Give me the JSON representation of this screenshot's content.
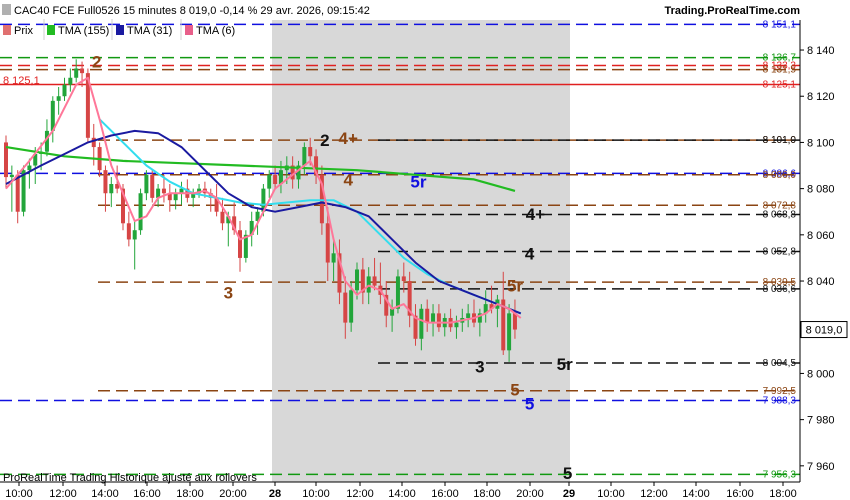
{
  "header": {
    "title": "CAC40 FCE Full0526 15 minutes 8 019,0 -0,14 % 29 avr. 2026, 09:15:42",
    "site": "Trading.ProRealTime.com"
  },
  "legend": [
    {
      "label": "Prix",
      "color": "#e07070"
    },
    {
      "label": "TMA (155)",
      "color": "#22bb22"
    },
    {
      "label": "TMA (31)",
      "color": "#1a1aa0"
    },
    {
      "label": "TMA (6)",
      "color": "#e85f8a"
    }
  ],
  "footer_note": "ProRealTime Trading  Historique ajusté aux rollovers",
  "price_label": "8 019,0",
  "left_label": "8 125,1",
  "colors": {
    "up": "#22a53a",
    "down": "#d64545",
    "red_line": "#e02020",
    "brown": "#8b4513",
    "blue": "#1010e0",
    "green": "#119911",
    "black": "#111111",
    "tma155": "#22bb22",
    "tma31": "#1a1aa0",
    "tma6": "#ff7799",
    "cyan": "#33ddee"
  },
  "chart_data": {
    "type": "candlestick",
    "y_ticks": [
      "8 140",
      "8 120",
      "8 100",
      "8 080",
      "8 060",
      "8 040",
      "8 020",
      "8 000",
      "7 980",
      "7 960"
    ],
    "y_values": [
      8140,
      8120,
      8100,
      8080,
      8060,
      8040,
      8020,
      8000,
      7980,
      7960
    ],
    "ylim": [
      7953,
      8153
    ],
    "x_ticks": [
      "10:00",
      "12:00",
      "14:00",
      "16:00",
      "18:00",
      "20:00",
      "28",
      "10:00",
      "12:00",
      "14:00",
      "16:00",
      "18:00",
      "20:00",
      "29",
      "10:00",
      "12:00",
      "14:00",
      "16:00",
      "18:00"
    ],
    "x_labels_bold": [
      "28",
      "29"
    ],
    "levels": [
      {
        "label": "8 151,1",
        "value": 8151.1,
        "color": "blue",
        "style": "dash"
      },
      {
        "label": "8 136,7",
        "value": 8136.7,
        "color": "green",
        "style": "dash"
      },
      {
        "label": "8 133,3",
        "value": 8133.3,
        "color": "red",
        "style": "dash"
      },
      {
        "label": "8 131,5",
        "value": 8131.5,
        "color": "brown",
        "style": "dash"
      },
      {
        "label": "8 125,1",
        "value": 8125.1,
        "color": "red_line",
        "style": "solid"
      },
      {
        "label": "8 101,0",
        "value": 8101.0,
        "color": "brown",
        "style": "dash"
      },
      {
        "label": "8 101,0",
        "value": 8101.0,
        "color": "black",
        "style": "dash"
      },
      {
        "label": "8 086,6",
        "value": 8086.6,
        "color": "blue",
        "style": "dash"
      },
      {
        "label": "8 086,0",
        "value": 8086.0,
        "color": "brown",
        "style": "dash"
      },
      {
        "label": "8 072,8",
        "value": 8072.8,
        "color": "brown",
        "style": "dash"
      },
      {
        "label": "8 068,8",
        "value": 8068.8,
        "color": "black",
        "style": "dash"
      },
      {
        "label": "8 052,8",
        "value": 8052.8,
        "color": "black",
        "style": "dash"
      },
      {
        "label": "8 039,5",
        "value": 8039.5,
        "color": "brown",
        "style": "dash"
      },
      {
        "label": "8 036,6",
        "value": 8036.6,
        "color": "black",
        "style": "dash"
      },
      {
        "label": "8 004,5",
        "value": 8004.5,
        "color": "black",
        "style": "dash"
      },
      {
        "label": "7 992,5",
        "value": 7992.5,
        "color": "brown",
        "style": "dash"
      },
      {
        "label": "7 988,3",
        "value": 7988.3,
        "color": "blue",
        "style": "dash"
      },
      {
        "label": "7 956,3",
        "value": 7956.3,
        "color": "green",
        "style": "dash"
      }
    ],
    "annotations": [
      {
        "text": "2",
        "x": 15.5,
        "y": 8135,
        "color": "brown"
      },
      {
        "text": "2",
        "x": 54.5,
        "y": 8101,
        "color": "black"
      },
      {
        "text": "4+",
        "x": 58.5,
        "y": 8102,
        "color": "brown"
      },
      {
        "text": "4",
        "x": 58.5,
        "y": 8084,
        "color": "brown"
      },
      {
        "text": "5r",
        "x": 70.5,
        "y": 8083,
        "color": "blue"
      },
      {
        "text": "4+",
        "x": 90.5,
        "y": 8069,
        "color": "black"
      },
      {
        "text": "4",
        "x": 89.5,
        "y": 8052,
        "color": "black"
      },
      {
        "text": "3",
        "x": 38,
        "y": 8035,
        "color": "brown"
      },
      {
        "text": "5r",
        "x": 87,
        "y": 8038,
        "color": "brown"
      },
      {
        "text": "5r",
        "x": 95.5,
        "y": 8004,
        "color": "black"
      },
      {
        "text": "3",
        "x": 81,
        "y": 8003,
        "color": "black"
      },
      {
        "text": "5",
        "x": 87,
        "y": 7993,
        "color": "brown"
      },
      {
        "text": "5",
        "x": 89.5,
        "y": 7987,
        "color": "blue"
      },
      {
        "text": "5",
        "x": 96,
        "y": 7957,
        "color": "black"
      }
    ],
    "ohlc": [
      [
        8100,
        8103,
        8080,
        8085
      ],
      [
        8085,
        8090,
        8070,
        8086
      ],
      [
        8086,
        8088,
        8065,
        8070
      ],
      [
        8070,
        8090,
        8068,
        8088
      ],
      [
        8088,
        8093,
        8080,
        8090
      ],
      [
        8090,
        8098,
        8082,
        8095
      ],
      [
        8095,
        8100,
        8088,
        8096
      ],
      [
        8096,
        8110,
        8094,
        8105
      ],
      [
        8105,
        8120,
        8100,
        8118
      ],
      [
        8118,
        8124,
        8112,
        8120
      ],
      [
        8120,
        8128,
        8118,
        8125
      ],
      [
        8125,
        8132,
        8122,
        8128
      ],
      [
        8128,
        8136,
        8126,
        8132
      ],
      [
        8132,
        8135,
        8124,
        8130
      ],
      [
        8130,
        8132,
        8100,
        8102
      ],
      [
        8102,
        8108,
        8090,
        8098
      ],
      [
        8098,
        8100,
        8085,
        8088
      ],
      [
        8088,
        8090,
        8070,
        8078
      ],
      [
        8078,
        8085,
        8072,
        8082
      ],
      [
        8082,
        8090,
        8078,
        8080
      ],
      [
        8080,
        8082,
        8062,
        8065
      ],
      [
        8065,
        8070,
        8055,
        8058
      ],
      [
        8058,
        8066,
        8045,
        8062
      ],
      [
        8062,
        8080,
        8060,
        8078
      ],
      [
        8078,
        8088,
        8075,
        8086
      ],
      [
        8086,
        8088,
        8074,
        8076
      ],
      [
        8076,
        8082,
        8072,
        8080
      ],
      [
        8080,
        8086,
        8074,
        8078
      ],
      [
        8078,
        8082,
        8070,
        8075
      ],
      [
        8075,
        8080,
        8071,
        8078
      ],
      [
        8078,
        8083,
        8073,
        8080
      ],
      [
        8080,
        8084,
        8074,
        8076
      ],
      [
        8076,
        8080,
        8072,
        8078
      ],
      [
        8078,
        8082,
        8076,
        8080
      ],
      [
        8080,
        8083,
        8076,
        8078
      ],
      [
        8078,
        8080,
        8070,
        8076
      ],
      [
        8076,
        8082,
        8068,
        8070
      ],
      [
        8070,
        8076,
        8062,
        8065
      ],
      [
        8065,
        8070,
        8055,
        8068
      ],
      [
        8068,
        8074,
        8060,
        8062
      ],
      [
        8062,
        8066,
        8044,
        8050
      ],
      [
        8050,
        8062,
        8048,
        8060
      ],
      [
        8060,
        8070,
        8055,
        8066
      ],
      [
        8066,
        8072,
        8060,
        8070
      ],
      [
        8070,
        8082,
        8068,
        8080
      ],
      [
        8080,
        8088,
        8076,
        8086
      ],
      [
        8086,
        8090,
        8080,
        8082
      ],
      [
        8082,
        8092,
        8078,
        8088
      ],
      [
        8088,
        8094,
        8082,
        8090
      ],
      [
        8090,
        8094,
        8080,
        8084
      ],
      [
        8084,
        8092,
        8080,
        8090
      ],
      [
        8090,
        8100,
        8086,
        8098
      ],
      [
        8098,
        8102,
        8090,
        8094
      ],
      [
        8094,
        8097,
        8082,
        8086
      ],
      [
        8086,
        8090,
        8060,
        8065
      ],
      [
        8065,
        8072,
        8040,
        8048
      ],
      [
        8048,
        8058,
        8040,
        8052
      ],
      [
        8052,
        8058,
        8030,
        8035
      ],
      [
        8035,
        8042,
        8015,
        8022
      ],
      [
        8022,
        8040,
        8018,
        8036
      ],
      [
        8036,
        8048,
        8032,
        8045
      ],
      [
        8045,
        8050,
        8030,
        8035
      ],
      [
        8035,
        8046,
        8030,
        8042
      ],
      [
        8042,
        8050,
        8036,
        8038
      ],
      [
        8038,
        8048,
        8030,
        8034
      ],
      [
        8034,
        8040,
        8020,
        8025
      ],
      [
        8025,
        8032,
        8018,
        8028
      ],
      [
        8028,
        8045,
        8026,
        8042
      ],
      [
        8042,
        8048,
        8035,
        8040
      ],
      [
        8040,
        8044,
        8020,
        8025
      ],
      [
        8025,
        8030,
        8012,
        8015
      ],
      [
        8015,
        8030,
        8010,
        8028
      ],
      [
        8028,
        8032,
        8018,
        8022
      ],
      [
        8022,
        8030,
        8016,
        8026
      ],
      [
        8026,
        8030,
        8018,
        8020
      ],
      [
        8020,
        8026,
        8016,
        8024
      ],
      [
        8024,
        8028,
        8018,
        8020
      ],
      [
        8020,
        8025,
        8015,
        8022
      ],
      [
        8022,
        8028,
        8018,
        8024
      ],
      [
        8024,
        8030,
        8020,
        8026
      ],
      [
        8026,
        8032,
        8020,
        8022
      ],
      [
        8022,
        8028,
        8016,
        8026
      ],
      [
        8026,
        8036,
        8022,
        8030
      ],
      [
        8030,
        8038,
        8026,
        8028
      ],
      [
        8028,
        8034,
        8020,
        8032
      ],
      [
        8032,
        8044,
        8008,
        8010
      ],
      [
        8010,
        8030,
        8005,
        8026
      ],
      [
        8026,
        8032,
        8015,
        8019
      ]
    ],
    "tma155": [
      [
        0,
        8098
      ],
      [
        10,
        8094
      ],
      [
        20,
        8092
      ],
      [
        30,
        8091
      ],
      [
        40,
        8090
      ],
      [
        50,
        8089
      ],
      [
        60,
        8088
      ],
      [
        70,
        8086
      ],
      [
        80,
        8084
      ],
      [
        87,
        8079
      ]
    ],
    "tma31": [
      [
        0,
        8082
      ],
      [
        6,
        8090
      ],
      [
        10,
        8095
      ],
      [
        14,
        8100
      ],
      [
        18,
        8103
      ],
      [
        22,
        8105
      ],
      [
        26,
        8104
      ],
      [
        30,
        8098
      ],
      [
        34,
        8088
      ],
      [
        38,
        8078
      ],
      [
        42,
        8072
      ],
      [
        46,
        8070
      ],
      [
        50,
        8072
      ],
      [
        54,
        8074
      ],
      [
        58,
        8072
      ],
      [
        62,
        8068
      ],
      [
        66,
        8058
      ],
      [
        70,
        8048
      ],
      [
        74,
        8040
      ],
      [
        78,
        8036
      ],
      [
        82,
        8032
      ],
      [
        86,
        8028
      ],
      [
        88,
        8026
      ]
    ],
    "cyan_ma": [
      [
        16,
        8110
      ],
      [
        20,
        8100
      ],
      [
        24,
        8090
      ],
      [
        28,
        8083
      ],
      [
        32,
        8078
      ],
      [
        36,
        8076
      ],
      [
        40,
        8074
      ],
      [
        44,
        8073
      ],
      [
        48,
        8074
      ],
      [
        52,
        8075
      ],
      [
        56,
        8075
      ],
      [
        60,
        8070
      ],
      [
        64,
        8060
      ],
      [
        68,
        8050
      ],
      [
        72,
        8043
      ],
      [
        76,
        8038
      ],
      [
        80,
        8034
      ],
      [
        84,
        8030
      ],
      [
        88,
        8026
      ]
    ],
    "tma6": [
      [
        0,
        8080
      ],
      [
        4,
        8092
      ],
      [
        8,
        8105
      ],
      [
        12,
        8125
      ],
      [
        14,
        8128
      ],
      [
        16,
        8110
      ],
      [
        18,
        8090
      ],
      [
        20,
        8078
      ],
      [
        22,
        8066
      ],
      [
        24,
        8068
      ],
      [
        26,
        8076
      ],
      [
        28,
        8078
      ],
      [
        30,
        8078
      ],
      [
        32,
        8078
      ],
      [
        34,
        8079
      ],
      [
        36,
        8076
      ],
      [
        38,
        8068
      ],
      [
        40,
        8058
      ],
      [
        42,
        8060
      ],
      [
        44,
        8070
      ],
      [
        46,
        8080
      ],
      [
        48,
        8084
      ],
      [
        50,
        8088
      ],
      [
        52,
        8092
      ],
      [
        54,
        8082
      ],
      [
        56,
        8058
      ],
      [
        58,
        8040
      ],
      [
        60,
        8034
      ],
      [
        62,
        8038
      ],
      [
        64,
        8036
      ],
      [
        66,
        8028
      ],
      [
        68,
        8030
      ],
      [
        70,
        8024
      ],
      [
        72,
        8022
      ],
      [
        74,
        8022
      ],
      [
        76,
        8022
      ],
      [
        78,
        8023
      ],
      [
        80,
        8024
      ],
      [
        82,
        8026
      ],
      [
        84,
        8030
      ],
      [
        86,
        8028
      ],
      [
        88,
        8024
      ]
    ]
  }
}
